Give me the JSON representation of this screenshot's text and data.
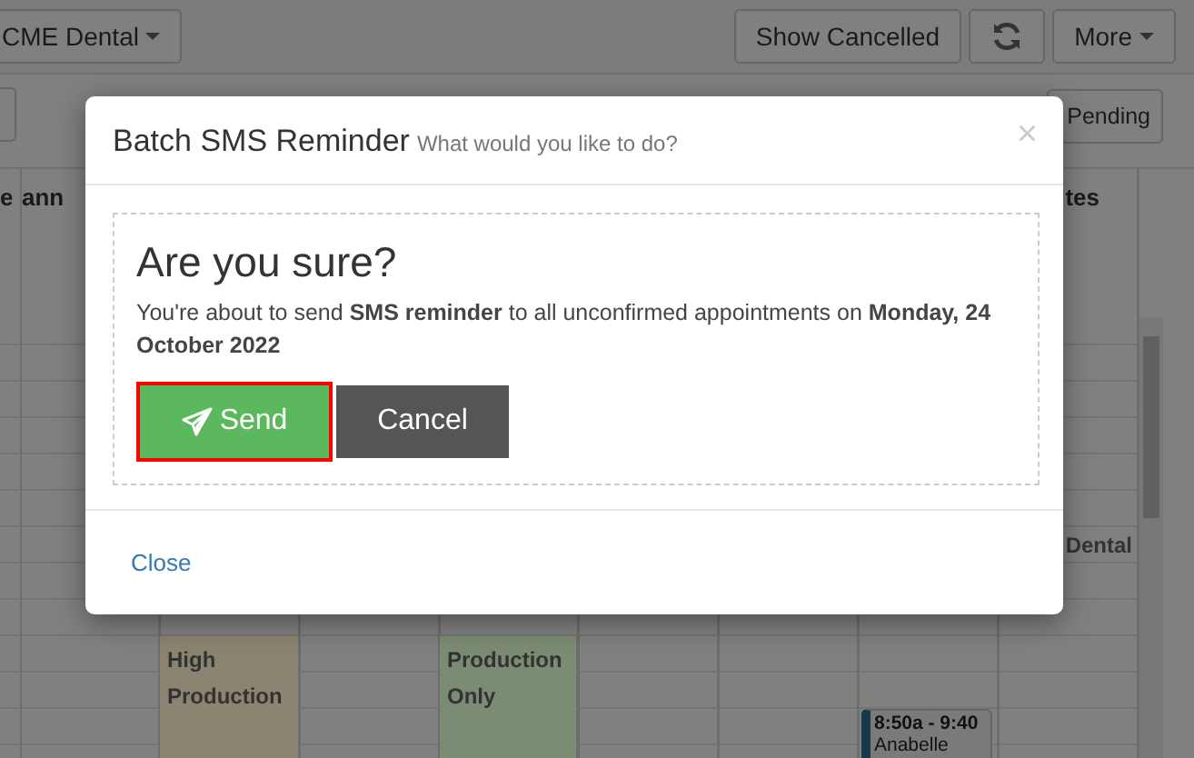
{
  "toolbar": {
    "location": "CME Dental",
    "buttons": [
      {
        "kind": "text",
        "label": "Show Cancelled"
      },
      {
        "kind": "refresh"
      },
      {
        "kind": "dropdown",
        "label": "More"
      }
    ]
  },
  "subbar": {
    "pending": "Pending"
  },
  "schedule": {
    "headers": [
      "e",
      "ann",
      "tes"
    ],
    "cells": [
      "Dental"
    ],
    "blocks": [
      {
        "text": "High Production",
        "color": "#8a8470"
      },
      {
        "text": "Production Only",
        "color": "#7c8b73"
      }
    ],
    "appointments": [
      {
        "time": "8:50a - 9:40",
        "name": "Anabelle"
      }
    ]
  },
  "modal": {
    "title": "Batch SMS Reminder",
    "subtitle": "What would you like to do?",
    "close_icon": "×",
    "heading": "Are you sure?",
    "message": "You're about to send **SMS reminder** to all unconfirmed appointments on **Monday, 24 October 2022**",
    "send": {
      "label": "Send",
      "focused": true
    },
    "cancel": "Cancel",
    "footer_link": "Close"
  }
}
